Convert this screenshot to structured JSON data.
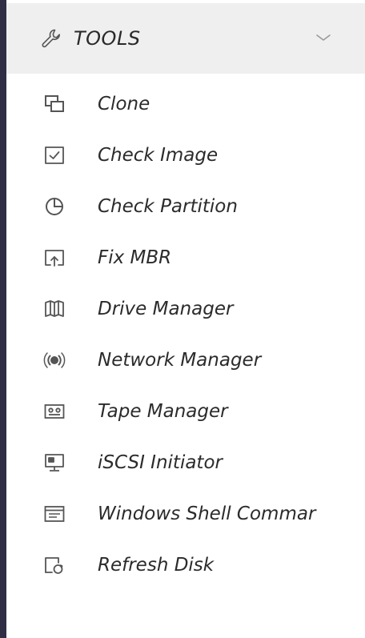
{
  "section": {
    "title": "TOOLS",
    "icon": "wrench-icon",
    "toggle_icon": "chevron-down-icon"
  },
  "menu": {
    "items": [
      {
        "label": "Clone",
        "icon": "clone-icon"
      },
      {
        "label": "Check Image",
        "icon": "check-image-icon"
      },
      {
        "label": "Check Partition",
        "icon": "pie-chart-icon"
      },
      {
        "label": "Fix MBR",
        "icon": "fix-mbr-icon"
      },
      {
        "label": "Drive Manager",
        "icon": "drive-manager-icon"
      },
      {
        "label": "Network Manager",
        "icon": "network-icon"
      },
      {
        "label": "Tape Manager",
        "icon": "tape-icon"
      },
      {
        "label": "iSCSI Initiator",
        "icon": "monitor-icon"
      },
      {
        "label": "Windows Shell Commar",
        "icon": "shell-window-icon"
      },
      {
        "label": "Refresh Disk",
        "icon": "refresh-disk-icon"
      }
    ]
  },
  "colors": {
    "sidebar_border": "#2f2e45",
    "header_background": "#efefef",
    "text": "#2b2b2b",
    "icon": "#555555"
  }
}
